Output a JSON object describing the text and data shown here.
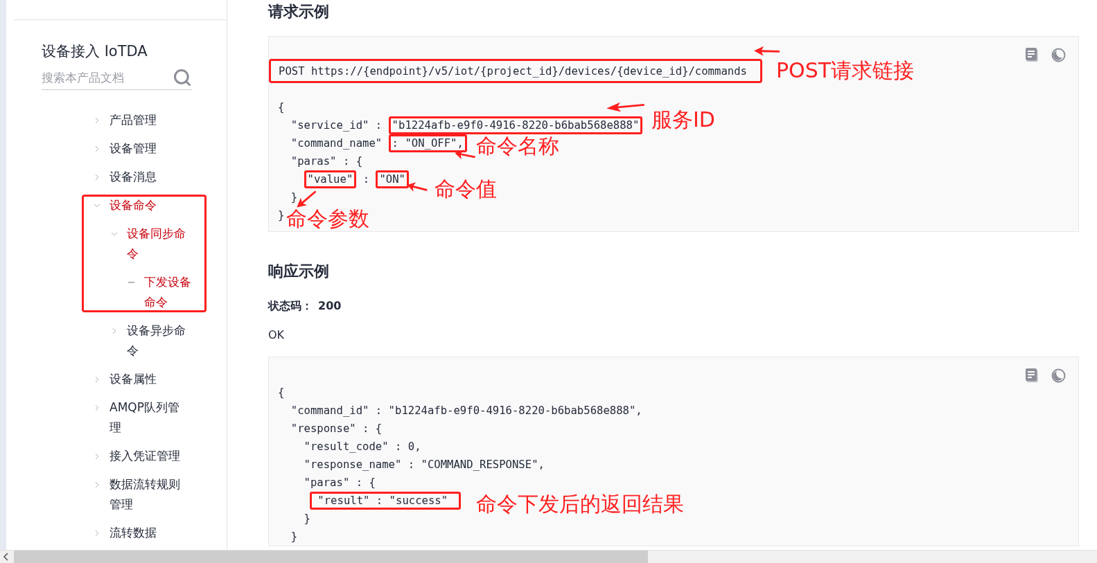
{
  "sidebar": {
    "title": "设备接入 IoTDA",
    "search": {
      "placeholder": "搜索本产品文档"
    },
    "nav": [
      {
        "label": "产品管理",
        "expanded": false,
        "selected": false
      },
      {
        "label": "设备管理",
        "expanded": false,
        "selected": false
      },
      {
        "label": "设备消息",
        "expanded": false,
        "selected": false
      },
      {
        "label": "设备命令",
        "expanded": true,
        "selected": true,
        "children": [
          {
            "label": "设备同步命令",
            "expanded": true,
            "selected": true,
            "children": [
              {
                "label": "下发设备命令",
                "selected": true
              }
            ]
          },
          {
            "label": "设备异步命令",
            "expanded": false,
            "selected": false
          }
        ]
      },
      {
        "label": "设备属性",
        "expanded": false,
        "selected": false
      },
      {
        "label": "AMQP队列管理",
        "expanded": false,
        "selected": false
      },
      {
        "label": "接入凭证管理",
        "expanded": false,
        "selected": false
      },
      {
        "label": "数据流转规则管理",
        "expanded": false,
        "selected": false
      },
      {
        "label": "流转数据",
        "expanded": false,
        "selected": false
      }
    ]
  },
  "request": {
    "heading": "请求示例",
    "url": "POST https://{endpoint}/v5/iot/{project_id}/devices/{device_id}/commands",
    "lines": [
      [
        {
          "text": "{",
          "boxed": false
        }
      ],
      [
        {
          "text": "  \"service_id\" : ",
          "boxed": false
        },
        {
          "text": "\"b1224afb-e9f0-4916-8220-b6bab568e888\"",
          "boxed": true
        }
      ],
      [
        {
          "text": "  \"command_name\" ",
          "boxed": false
        },
        {
          "text": ": \"ON_OFF\",",
          "boxed": true
        }
      ],
      [
        {
          "text": "  \"paras\" : {",
          "boxed": false
        }
      ],
      [
        {
          "text": "\"value\"",
          "boxed": true
        },
        {
          "text": " : ",
          "boxed": false
        },
        {
          "text": "\"ON\"",
          "boxed": true
        }
      ],
      [
        {
          "text": "  }",
          "boxed": false
        }
      ],
      [
        {
          "text": "}",
          "boxed": false
        }
      ]
    ],
    "annotations": [
      {
        "text": "POST请求链接"
      },
      {
        "text": "服务ID"
      },
      {
        "text": "命令名称"
      },
      {
        "text": "命令值"
      },
      {
        "text": "命令参数"
      }
    ]
  },
  "response": {
    "heading": "响应示例",
    "status_label": "状态码：",
    "status_code": "200",
    "status_text": "OK",
    "lines": [
      [
        {
          "text": "{",
          "boxed": false
        }
      ],
      [
        {
          "text": "  \"command_id\" : \"b1224afb-e9f0-4916-8220-b6bab568e888\",",
          "boxed": false
        }
      ],
      [
        {
          "text": "  \"response\" : {",
          "boxed": false
        }
      ],
      [
        {
          "text": "    \"result_code\" : 0,",
          "boxed": false
        }
      ],
      [
        {
          "text": "    \"response_name\" : \"COMMAND_RESPONSE\",",
          "boxed": false
        }
      ],
      [
        {
          "text": "    \"paras\" : {",
          "boxed": false
        }
      ],
      [
        {
          "text": "\"result\" : \"success\"",
          "boxed": true
        }
      ],
      [
        {
          "text": "    }",
          "boxed": false
        }
      ],
      [
        {
          "text": "  }",
          "boxed": false
        }
      ]
    ],
    "annotations": [
      {
        "text": "命令下发后的返回结果"
      }
    ]
  }
}
